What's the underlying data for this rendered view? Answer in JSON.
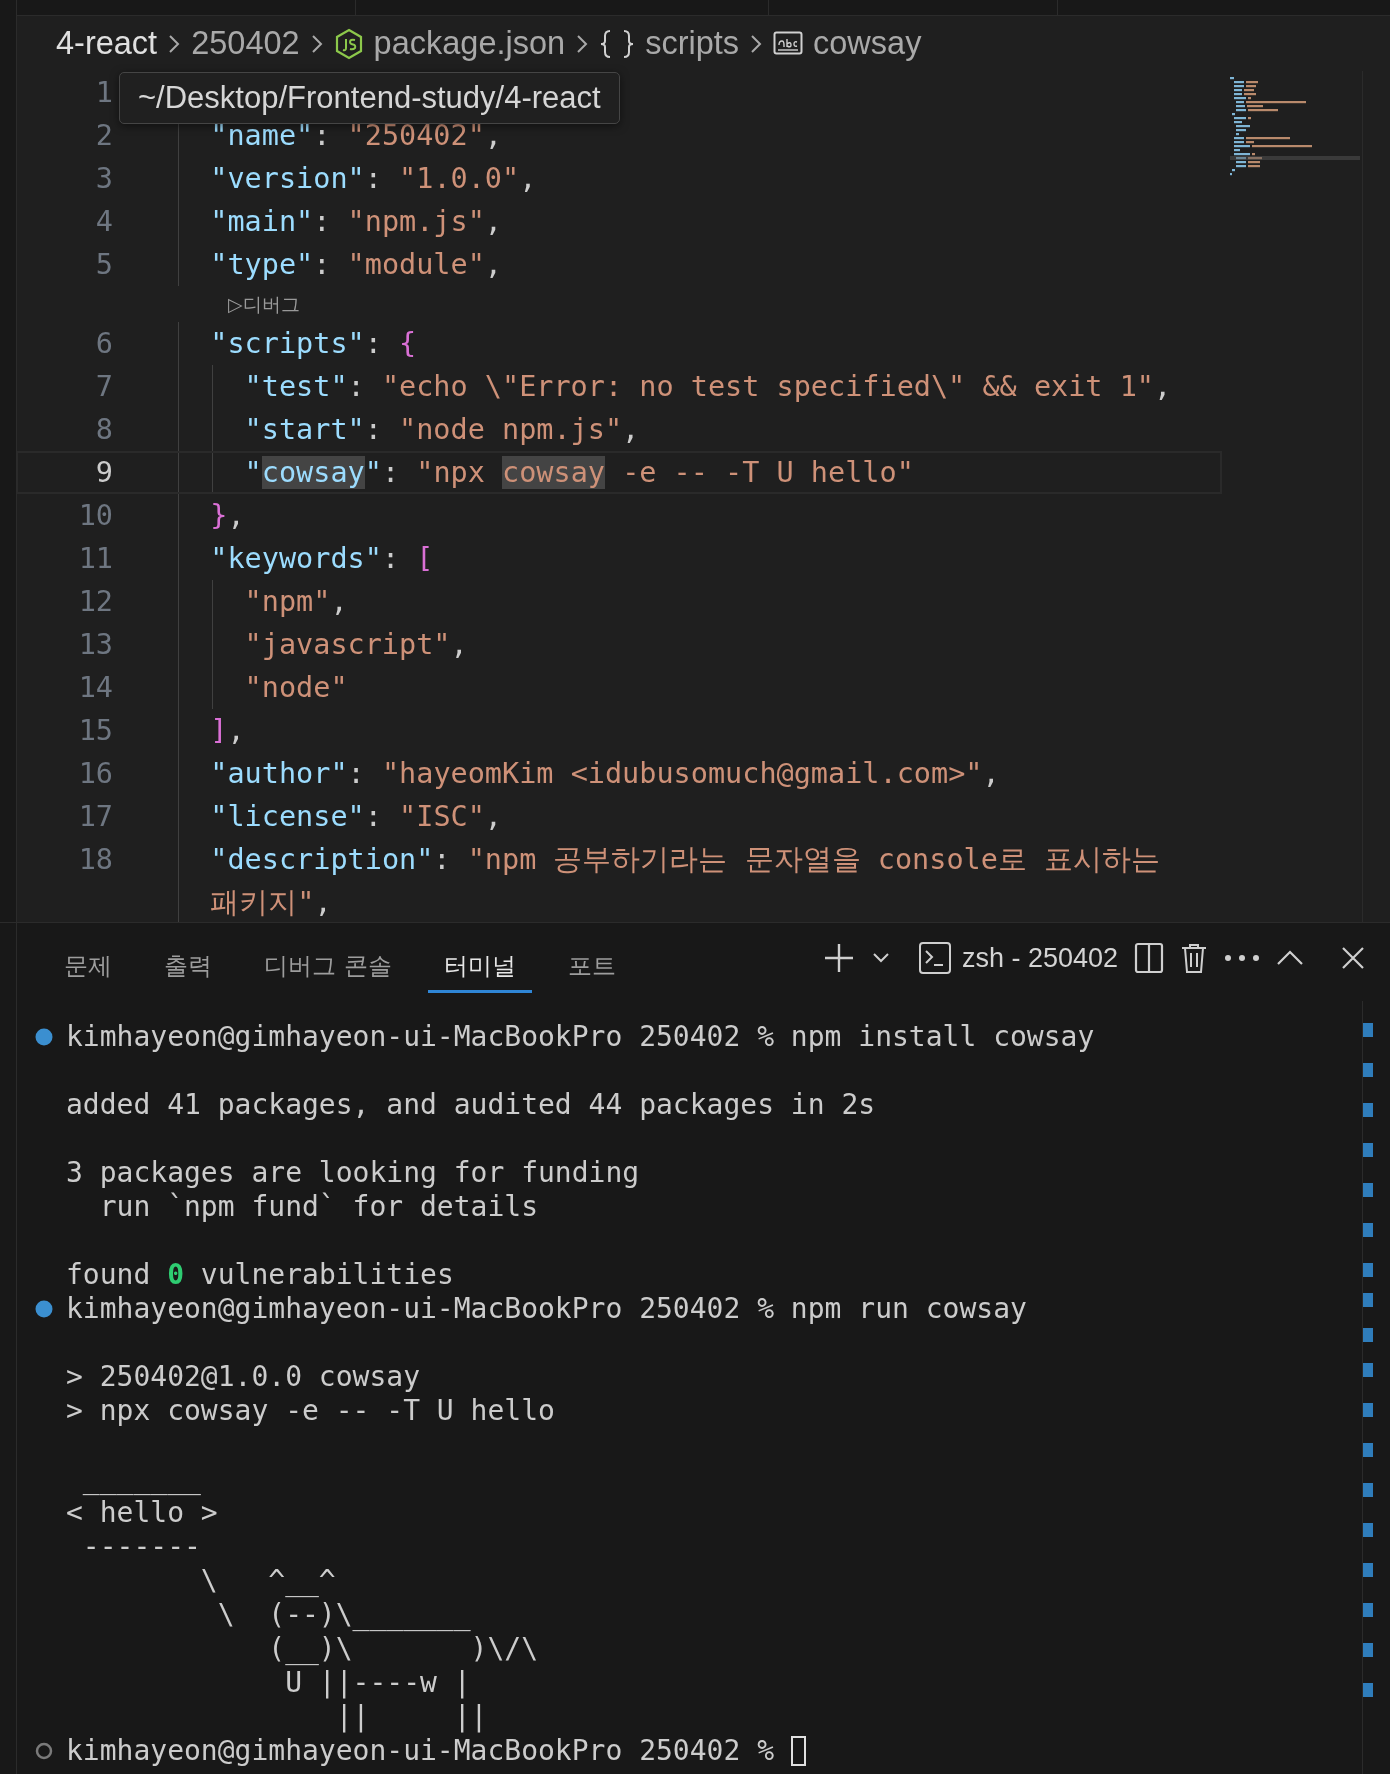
{
  "breadcrumbs": [
    {
      "text": "4-react",
      "kind": "folder",
      "hovered": true
    },
    {
      "text": "250402",
      "kind": "folder",
      "hovered": false
    },
    {
      "text": "package.json",
      "kind": "file",
      "hovered": false
    },
    {
      "text": "scripts",
      "kind": "object",
      "hovered": false
    },
    {
      "text": "cowsay",
      "kind": "string",
      "hovered": false
    }
  ],
  "tooltip": {
    "text": "~/Desktop/Frontend-study/4-react"
  },
  "editor": {
    "lines": [
      {
        "number": "1",
        "current": false
      },
      {
        "number": "2",
        "current": false,
        "tokens": [
          {
            "kind": "key",
            "text": "  \"name\""
          },
          {
            "kind": "punct",
            "text": ": "
          },
          {
            "kind": "string",
            "text": "\"250402\""
          },
          {
            "kind": "punct",
            "text": ","
          }
        ]
      },
      {
        "number": "3",
        "current": false,
        "tokens": [
          {
            "kind": "key",
            "text": "  \"version\""
          },
          {
            "kind": "punct",
            "text": ": "
          },
          {
            "kind": "string",
            "text": "\"1.0.0\""
          },
          {
            "kind": "punct",
            "text": ","
          }
        ]
      },
      {
        "number": "4",
        "current": false,
        "tokens": [
          {
            "kind": "key",
            "text": "  \"main\""
          },
          {
            "kind": "punct",
            "text": ": "
          },
          {
            "kind": "string",
            "text": "\"npm.js\""
          },
          {
            "kind": "punct",
            "text": ","
          }
        ]
      },
      {
        "number": "5",
        "current": false,
        "tokens": [
          {
            "kind": "key",
            "text": "  \"type\""
          },
          {
            "kind": "punct",
            "text": ": "
          },
          {
            "kind": "string",
            "text": "\"module\""
          },
          {
            "kind": "punct",
            "text": ","
          }
        ]
      },
      {
        "number": "6",
        "current": false,
        "codelens": "▷디버그",
        "tokens": [
          {
            "kind": "key",
            "text": "  \"scripts\""
          },
          {
            "kind": "punct",
            "text": ": "
          },
          {
            "kind": "bracket",
            "text": "{"
          }
        ]
      },
      {
        "number": "7",
        "current": false,
        "tokens": [
          {
            "kind": "key",
            "text": "    \"test\""
          },
          {
            "kind": "punct",
            "text": ": "
          },
          {
            "kind": "string",
            "text": "\"echo \\\"Error: no test specified\\\" && exit 1\""
          },
          {
            "kind": "punct",
            "text": ","
          }
        ]
      },
      {
        "number": "8",
        "current": false,
        "tokens": [
          {
            "kind": "key",
            "text": "    \"start\""
          },
          {
            "kind": "punct",
            "text": ": "
          },
          {
            "kind": "string",
            "text": "\"node npm.js\""
          },
          {
            "kind": "punct",
            "text": ","
          }
        ]
      },
      {
        "number": "9",
        "current": true,
        "tokens": [
          {
            "kind": "key",
            "text": "    \""
          },
          {
            "kind": "key",
            "text": "cowsay",
            "highlighted": true
          },
          {
            "kind": "key",
            "text": "\""
          },
          {
            "kind": "punct",
            "text": ": "
          },
          {
            "kind": "string",
            "text": "\"npx "
          },
          {
            "kind": "string",
            "text": "cowsay",
            "highlighted": true
          },
          {
            "kind": "string",
            "text": " -e -- -T U hello\""
          }
        ]
      },
      {
        "number": "10",
        "current": false,
        "tokens": [
          {
            "kind": "bracket",
            "text": "  }"
          },
          {
            "kind": "punct",
            "text": ","
          }
        ]
      },
      {
        "number": "11",
        "current": false,
        "tokens": [
          {
            "kind": "key",
            "text": "  \"keywords\""
          },
          {
            "kind": "punct",
            "text": ": "
          },
          {
            "kind": "bracket",
            "text": "["
          }
        ]
      },
      {
        "number": "12",
        "current": false,
        "tokens": [
          {
            "kind": "string",
            "text": "    \"npm\""
          },
          {
            "kind": "punct",
            "text": ","
          }
        ]
      },
      {
        "number": "13",
        "current": false,
        "tokens": [
          {
            "kind": "string",
            "text": "    \"javascript\""
          },
          {
            "kind": "punct",
            "text": ","
          }
        ]
      },
      {
        "number": "14",
        "current": false,
        "tokens": [
          {
            "kind": "string",
            "text": "    \"node\""
          }
        ]
      },
      {
        "number": "15",
        "current": false,
        "tokens": [
          {
            "kind": "bracket",
            "text": "  ]"
          },
          {
            "kind": "punct",
            "text": ","
          }
        ]
      },
      {
        "number": "16",
        "current": false,
        "tokens": [
          {
            "kind": "key",
            "text": "  \"author\""
          },
          {
            "kind": "punct",
            "text": ": "
          },
          {
            "kind": "string",
            "text": "\"hayeomKim <idubusomuch@gmail.com>\""
          },
          {
            "kind": "punct",
            "text": ","
          }
        ]
      },
      {
        "number": "17",
        "current": false,
        "tokens": [
          {
            "kind": "key",
            "text": "  \"license\""
          },
          {
            "kind": "punct",
            "text": ": "
          },
          {
            "kind": "string",
            "text": "\"ISC\""
          },
          {
            "kind": "punct",
            "text": ","
          }
        ]
      },
      {
        "number": "18",
        "current": false,
        "tokens": [
          {
            "kind": "key",
            "text": "  \"description\""
          },
          {
            "kind": "punct",
            "text": ": "
          },
          {
            "kind": "string",
            "text": "\"npm 공부하기라는 문자열을 console로 표시하는 패키지\""
          },
          {
            "kind": "punct",
            "text": ","
          }
        ]
      }
    ]
  },
  "panel": {
    "tabs": [
      {
        "label": "문제",
        "selected": false
      },
      {
        "label": "출력",
        "selected": false
      },
      {
        "label": "디버그 콘솔",
        "selected": false
      },
      {
        "label": "터미널",
        "selected": true
      },
      {
        "label": "포트",
        "selected": false
      }
    ],
    "terminal_name": "zsh - 250402",
    "terminal": [
      {
        "kind": "prompt",
        "completed": true,
        "text": "kimhayeon@gimhayeon-ui-MacBookPro 250402 % npm install cowsay"
      },
      {
        "kind": "blank"
      },
      {
        "kind": "output",
        "text": "added 41 packages, and audited 44 packages in 2s"
      },
      {
        "kind": "blank"
      },
      {
        "kind": "output",
        "text": "3 packages are looking for funding"
      },
      {
        "kind": "output",
        "text": "  run `npm fund` for details"
      },
      {
        "kind": "blank"
      },
      {
        "kind": "output",
        "text": "found **0** vulnerabilities"
      },
      {
        "kind": "prompt",
        "completed": true,
        "text": "kimhayeon@gimhayeon-ui-MacBookPro 250402 % npm run cowsay"
      },
      {
        "kind": "blank"
      },
      {
        "kind": "output",
        "text": "> 250402@1.0.0 cowsay"
      },
      {
        "kind": "output",
        "text": "> npx cowsay -e -- -T U hello"
      },
      {
        "kind": "blank"
      },
      {
        "kind": "output",
        "text": " _______"
      },
      {
        "kind": "output",
        "text": "< hello >"
      },
      {
        "kind": "output",
        "text": " -------"
      },
      {
        "kind": "output",
        "text": "        \\   ^__^"
      },
      {
        "kind": "output",
        "text": "         \\  (--)\\_______"
      },
      {
        "kind": "output",
        "text": "            (__)\\       )\\/\\"
      },
      {
        "kind": "output",
        "text": "             U ||----w |"
      },
      {
        "kind": "output",
        "text": "                ||     ||"
      },
      {
        "kind": "prompt",
        "completed": false,
        "cursor": true,
        "text": "kimhayeon@gimhayeon-ui-MacBookPro 250402 % "
      }
    ]
  }
}
